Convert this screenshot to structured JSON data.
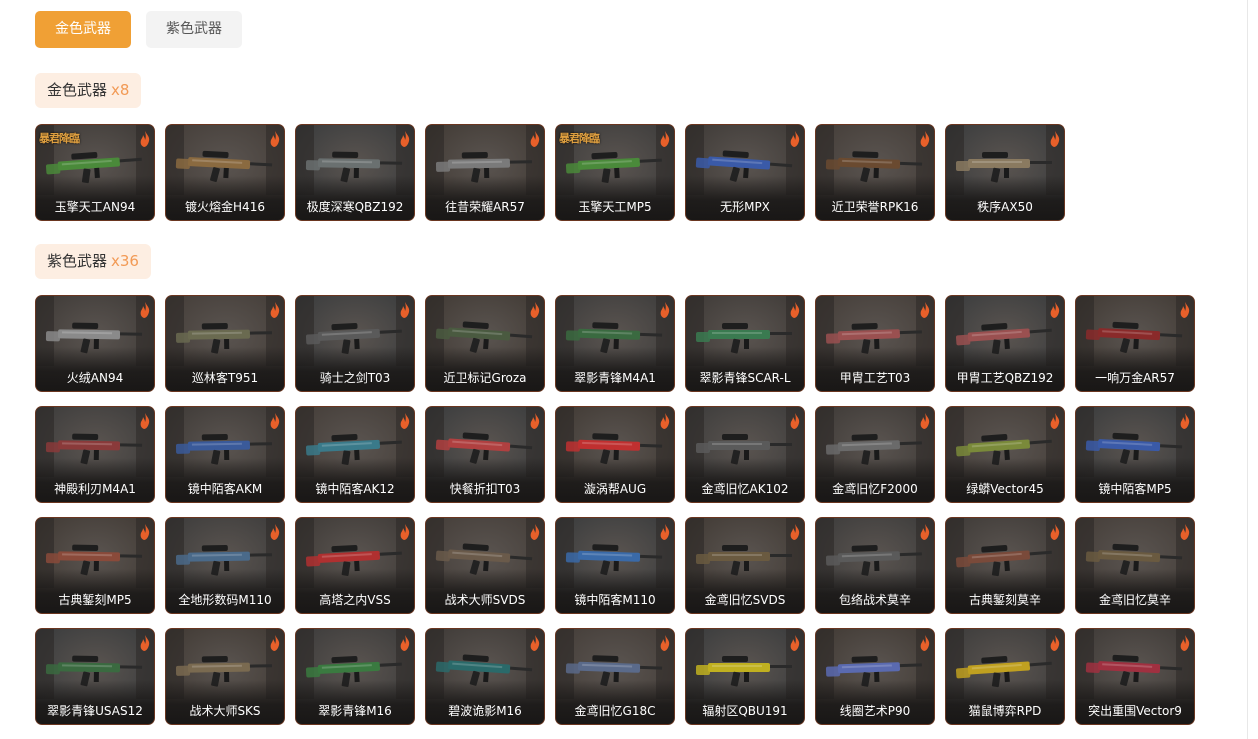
{
  "tabs": [
    {
      "label": "金色武器",
      "active": true
    },
    {
      "label": "紫色武器",
      "active": false
    }
  ],
  "sections": [
    {
      "title": "金色武器",
      "count": "x8",
      "items": [
        {
          "name": "玉擎天工AN94",
          "color": "#4a8a3a",
          "badge": "暴君降臨"
        },
        {
          "name": "镀火熔金H416",
          "color": "#8a6a40"
        },
        {
          "name": "极度深寒QBZ192",
          "color": "#6a7070"
        },
        {
          "name": "往昔荣耀AR57",
          "color": "#7a7a7a"
        },
        {
          "name": "玉擎天工MP5",
          "color": "#4a8a3a",
          "badge": "暴君降臨"
        },
        {
          "name": "无形MPX",
          "color": "#3a5aa8"
        },
        {
          "name": "近卫荣誉RPK16",
          "color": "#6a4a30"
        },
        {
          "name": "秩序AX50",
          "color": "#8a7a60"
        }
      ]
    },
    {
      "title": "紫色武器",
      "count": "x36",
      "items": [
        {
          "name": "火绒AN94",
          "color": "#8a8a8a"
        },
        {
          "name": "巡林客T951",
          "color": "#6a6a50"
        },
        {
          "name": "骑士之剑T03",
          "color": "#5a5a5a"
        },
        {
          "name": "近卫标记Groza",
          "color": "#4a5a40"
        },
        {
          "name": "翠影青锋M4A1",
          "color": "#3a6a40"
        },
        {
          "name": "翠影青锋SCAR-L",
          "color": "#3a7a50"
        },
        {
          "name": "甲胄工艺T03",
          "color": "#9a5050"
        },
        {
          "name": "甲胄工艺QBZ192",
          "color": "#9a5050"
        },
        {
          "name": "一响万金AR57",
          "color": "#8a2a2a"
        },
        {
          "name": "神殿利刃M4A1",
          "color": "#8a3a3a"
        },
        {
          "name": "镜中陌客AKM",
          "color": "#3a5a9a"
        },
        {
          "name": "镜中陌客AK12",
          "color": "#3a7a8a"
        },
        {
          "name": "快餐折扣T03",
          "color": "#b04040"
        },
        {
          "name": "漩涡帮AUG",
          "color": "#c03030"
        },
        {
          "name": "金鸢旧忆AK102",
          "color": "#5a5a5a"
        },
        {
          "name": "金鸢旧忆F2000",
          "color": "#6a6a6a"
        },
        {
          "name": "绿蟒Vector45",
          "color": "#7a8a3a"
        },
        {
          "name": "镜中陌客MP5",
          "color": "#3a5aa8"
        },
        {
          "name": "古典錾刻MP5",
          "color": "#8a4a3a"
        },
        {
          "name": "全地形数码M110",
          "color": "#4a6a8a"
        },
        {
          "name": "高塔之内VSS",
          "color": "#b03030"
        },
        {
          "name": "战术大师SVDS",
          "color": "#6a5a4a"
        },
        {
          "name": "镜中陌客M110",
          "color": "#3a6aa8"
        },
        {
          "name": "金鸢旧忆SVDS",
          "color": "#6a5a40"
        },
        {
          "name": "包络战术莫辛",
          "color": "#5a5a5a"
        },
        {
          "name": "古典錾刻莫辛",
          "color": "#7a4a3a"
        },
        {
          "name": "金鸢旧忆莫辛",
          "color": "#6a5a40"
        },
        {
          "name": "翠影青锋USAS12",
          "color": "#3a6a40"
        },
        {
          "name": "战术大师SKS",
          "color": "#7a6a50"
        },
        {
          "name": "翠影青锋M16",
          "color": "#3a7a40"
        },
        {
          "name": "碧波诡影M16",
          "color": "#2a6a6a"
        },
        {
          "name": "金鸢旧忆G18C",
          "color": "#5a6a8a"
        },
        {
          "name": "辐射区QBU191",
          "color": "#c0b020"
        },
        {
          "name": "线圈艺术P90",
          "color": "#5a6ab0"
        },
        {
          "name": "猫鼠博弈RPD",
          "color": "#c0a020"
        },
        {
          "name": "突出重围Vector9",
          "color": "#a03040"
        }
      ]
    }
  ]
}
